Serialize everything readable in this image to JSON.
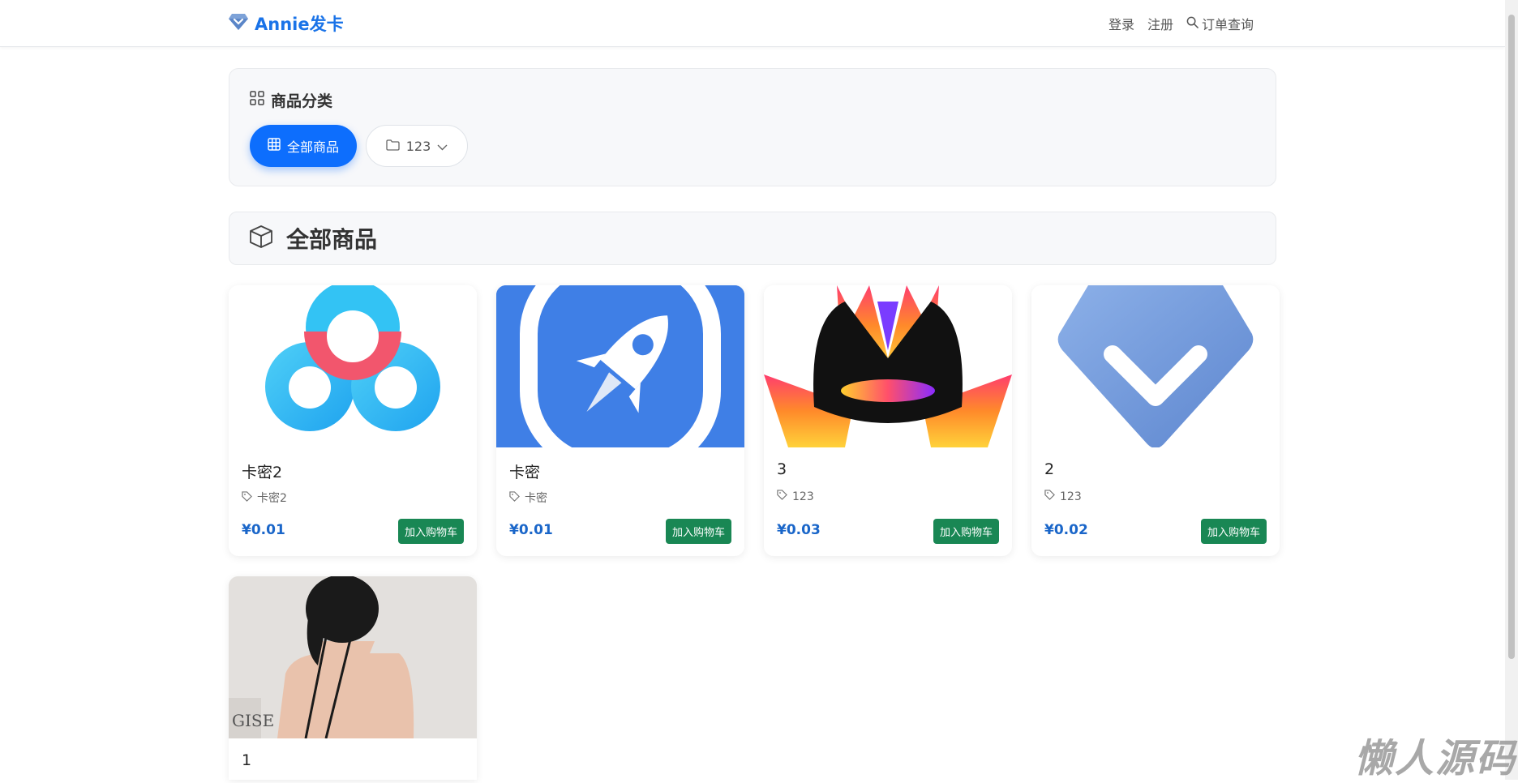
{
  "navbar": {
    "brand": "Annie发卡",
    "links": {
      "login": "登录",
      "register": "注册",
      "order_query": "订单查询"
    }
  },
  "categories": {
    "title": "商品分类",
    "all_label": "全部商品",
    "items": [
      {
        "label": "123"
      }
    ]
  },
  "section": {
    "title": "全部商品"
  },
  "products": [
    {
      "name": "卡密2",
      "tag": "卡密2",
      "price": "¥0.01",
      "button": "加入购物车"
    },
    {
      "name": "卡密",
      "tag": "卡密",
      "price": "¥0.01",
      "button": "加入购物车"
    },
    {
      "name": "3",
      "tag": "123",
      "price": "¥0.03",
      "button": "加入购物车"
    },
    {
      "name": "2",
      "tag": "123",
      "price": "¥0.02",
      "button": "加入购物车"
    },
    {
      "name": "1"
    }
  ],
  "watermark": "懒人源码",
  "colors": {
    "primary": "#0d6efd",
    "cart_button": "#198754",
    "price": "#1a66c9",
    "brand": "#1a73e8"
  }
}
